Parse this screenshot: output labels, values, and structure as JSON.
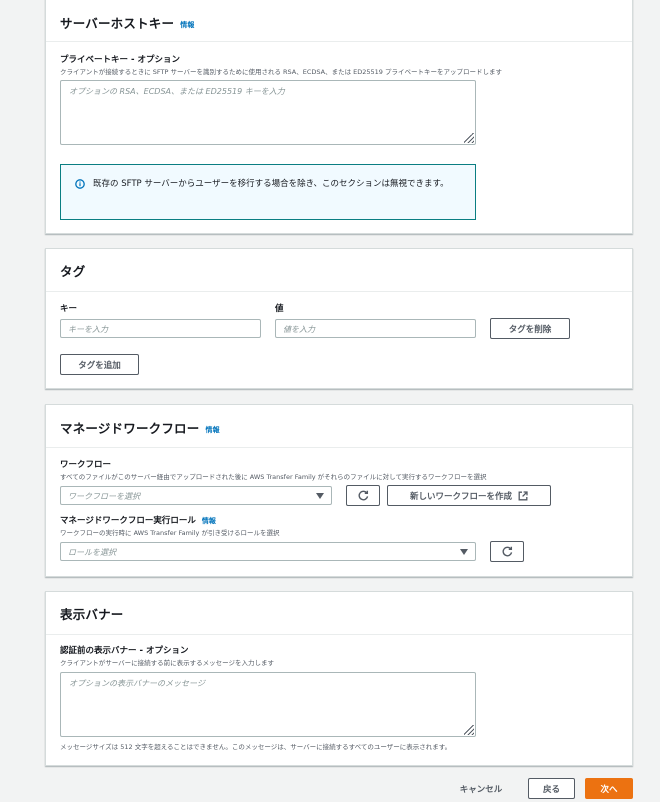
{
  "host_key": {
    "title": "サーバーホストキー",
    "info": "情報",
    "private_key_label": "プライベートキー - オプション",
    "private_key_desc": "クライアントが接続するときに SFTP サーバーを識別するために使用される RSA、ECDSA、または ED25519 プライベートキーをアップロードします",
    "private_key_placeholder": "オプションの RSA、ECDSA、または ED25519 キーを入力",
    "alert_text": "既存の SFTP サーバーからユーザーを移行する場合を除き、このセクションは無視できます。"
  },
  "tags": {
    "title": "タグ",
    "key_label": "キー",
    "value_label": "値",
    "key_placeholder": "キーを入力",
    "value_placeholder": "値を入力",
    "remove_button": "タグを削除",
    "add_button": "タグを追加"
  },
  "workflows": {
    "title": "マネージドワークフロー",
    "info": "情報",
    "workflow_label": "ワークフロー",
    "workflow_desc": "すべてのファイルがこのサーバー経由でアップロードされた後に AWS Transfer Family がそれらのファイルに対して実行するワークフローを選択",
    "workflow_placeholder": "ワークフローを選択",
    "create_workflow_button": "新しいワークフローを作成",
    "role_label": "マネージドワークフロー実行ロール",
    "role_info": "情報",
    "role_desc": "ワークフローの実行時に AWS Transfer Family が引き受けるロールを選択",
    "role_placeholder": "ロールを選択"
  },
  "banner": {
    "title": "表示バナー",
    "label": "認証前の表示バナー - オプション",
    "desc": "クライアントがサーバーに接続する前に表示するメッセージを入力します",
    "placeholder": "オプションの表示バナーのメッセージ",
    "constraint": "メッセージサイズは 512 文字を超えることはできません。このメッセージは、サーバーに接続するすべてのユーザーに表示されます。"
  },
  "footer": {
    "cancel": "キャンセル",
    "back": "戻る",
    "next": "次へ"
  },
  "colors": {
    "primary": "#ec7211",
    "link": "#0073bb",
    "alert_border": "#0a7e82"
  },
  "icons": [
    "info-circle-icon",
    "refresh-icon",
    "external-link-icon",
    "caret-down-icon",
    "resize-grip-icon"
  ]
}
